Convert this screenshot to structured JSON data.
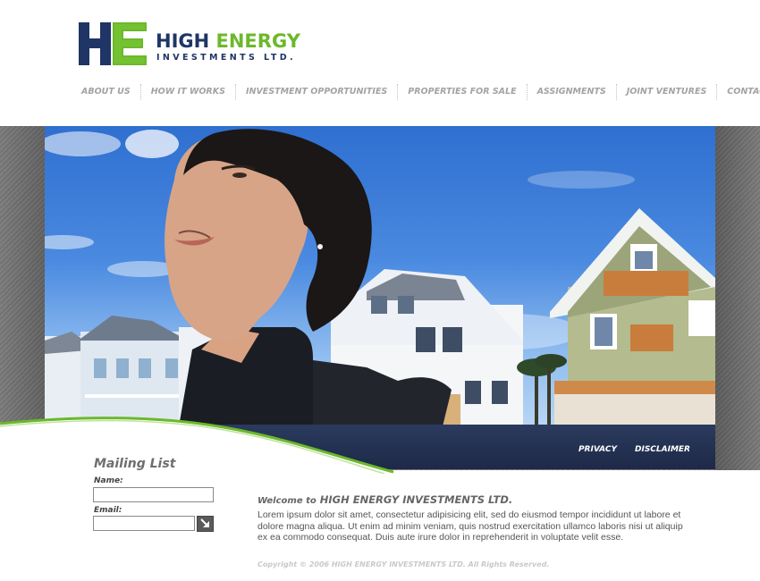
{
  "brand": {
    "logo_letters": "HE",
    "name_part1": "HIGH",
    "name_part2": "ENERGY",
    "subtitle": "INVESTMENTS LTD.",
    "primary_color": "#1e3565",
    "accent_color": "#6cb82c"
  },
  "nav": {
    "items": [
      {
        "label": "ABOUT US"
      },
      {
        "label": "HOW IT WORKS"
      },
      {
        "label": "INVESTMENT OPPORTUNITIES"
      },
      {
        "label": "PROPERTIES FOR SALE"
      },
      {
        "label": "ASSIGNMENTS"
      },
      {
        "label": "JOINT VENTURES"
      },
      {
        "label": "CONTACT US"
      }
    ]
  },
  "banner": {
    "image_description_icon": "woman-and-houses-photo",
    "footer_links": [
      {
        "label": "PRIVACY"
      },
      {
        "label": "DISCLAIMER"
      }
    ]
  },
  "mailing_list": {
    "title": "Mailing List",
    "name_label": "Name:",
    "name_value": "",
    "email_label": "Email:",
    "email_value": "",
    "submit_icon": "arrow-down-right-icon"
  },
  "welcome": {
    "prefix": "Welcome to",
    "company": "HIGH ENERGY INVESTMENTS LTD.",
    "body": "Lorem ipsum dolor sit amet, consectetur adipisicing elit, sed do eiusmod tempor incididunt ut labore et dolore magna aliqua. Ut enim ad minim veniam, quis nostrud exercitation ullamco laboris nisi ut aliquip ex ea commodo consequat. Duis aute irure dolor in reprehenderit in voluptate velit esse."
  },
  "copyright": "Copyright © 2006  HIGH ENERGY INVESTMENTS LTD.  All Rights Reserved."
}
